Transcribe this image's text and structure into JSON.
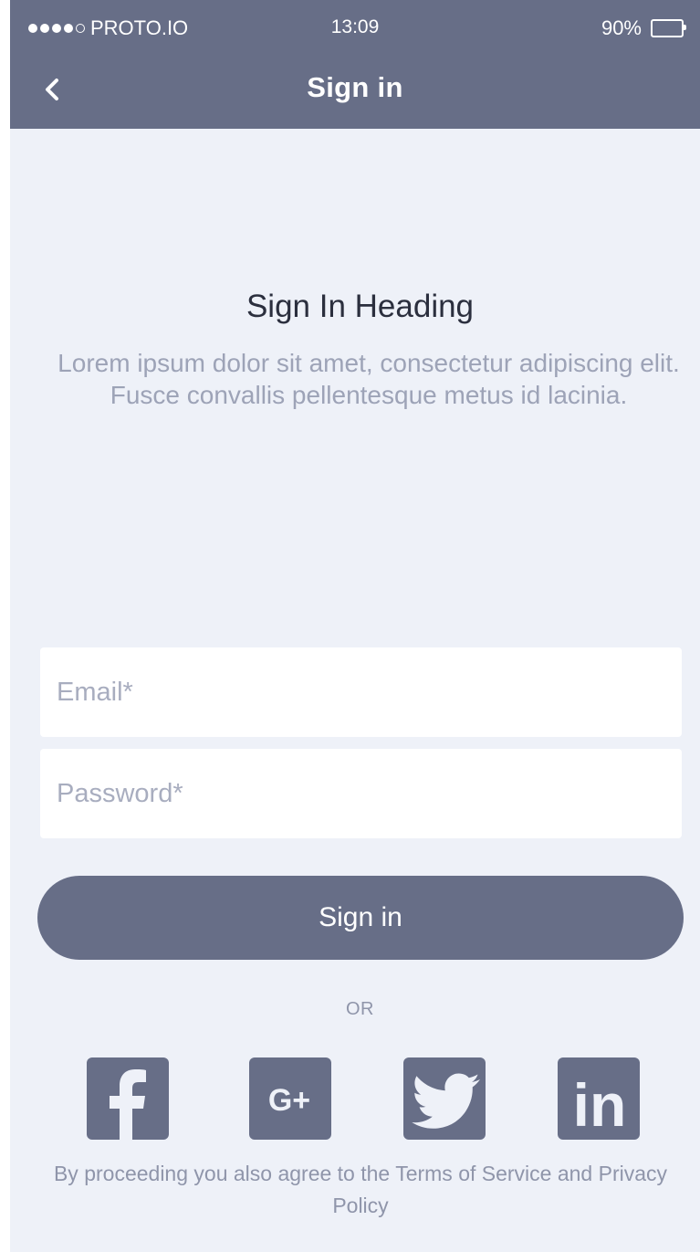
{
  "status_bar": {
    "carrier": "PROTO.IO",
    "time": "13:09",
    "battery": "90%"
  },
  "nav": {
    "back_icon": "chevron-left-icon",
    "title": "Sign in"
  },
  "content": {
    "heading": "Sign In Heading",
    "description": "Lorem ipsum dolor sit amet, consectetur adipiscing elit. Fusce convallis pellentesque metus id lacinia."
  },
  "form": {
    "email_placeholder": "Email*",
    "email_value": "",
    "password_placeholder": "Password*",
    "password_value": "",
    "submit_label": "Sign in"
  },
  "divider_label": "OR",
  "social": [
    {
      "name": "Facebook",
      "icon": "facebook-icon"
    },
    {
      "name": "Google+",
      "icon": "google-plus-icon",
      "text": "G+"
    },
    {
      "name": "Twitter",
      "icon": "twitter-icon"
    },
    {
      "name": "LinkedIn",
      "icon": "linkedin-icon",
      "text": "in"
    }
  ],
  "terms": "By proceeding you also agree to the Terms of Service and Privacy Policy",
  "colors": {
    "primary": "#676e87",
    "background": "#eef1f8",
    "heading": "#2b2f3e",
    "muted": "#9da3b7"
  }
}
